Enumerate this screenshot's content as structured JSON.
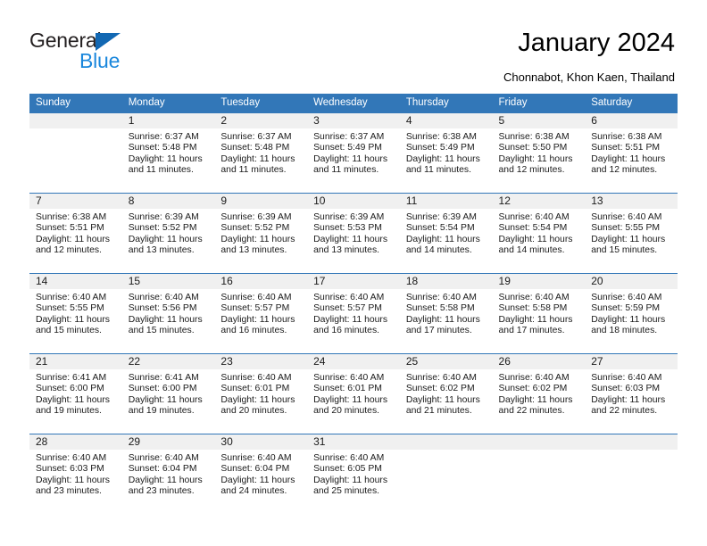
{
  "brand": {
    "name_part1": "General",
    "name_part2": "Blue",
    "triangle_icon": "triangle-icon",
    "color_dark": "#231f20",
    "color_blue": "#1a87dc",
    "color_triangle": "#1268b3"
  },
  "header": {
    "title": "January 2024",
    "subtitle": "Chonnabot, Khon Kaen, Thailand",
    "accent_color": "#3277b8",
    "band_color": "#f0f0f0"
  },
  "weekday_headers": [
    "Sunday",
    "Monday",
    "Tuesday",
    "Wednesday",
    "Thursday",
    "Friday",
    "Saturday"
  ],
  "weeks": [
    [
      {
        "day": "",
        "lines": []
      },
      {
        "day": "1",
        "lines": [
          "Sunrise: 6:37 AM",
          "Sunset: 5:48 PM",
          "Daylight: 11 hours",
          "and 11 minutes."
        ]
      },
      {
        "day": "2",
        "lines": [
          "Sunrise: 6:37 AM",
          "Sunset: 5:48 PM",
          "Daylight: 11 hours",
          "and 11 minutes."
        ]
      },
      {
        "day": "3",
        "lines": [
          "Sunrise: 6:37 AM",
          "Sunset: 5:49 PM",
          "Daylight: 11 hours",
          "and 11 minutes."
        ]
      },
      {
        "day": "4",
        "lines": [
          "Sunrise: 6:38 AM",
          "Sunset: 5:49 PM",
          "Daylight: 11 hours",
          "and 11 minutes."
        ]
      },
      {
        "day": "5",
        "lines": [
          "Sunrise: 6:38 AM",
          "Sunset: 5:50 PM",
          "Daylight: 11 hours",
          "and 12 minutes."
        ]
      },
      {
        "day": "6",
        "lines": [
          "Sunrise: 6:38 AM",
          "Sunset: 5:51 PM",
          "Daylight: 11 hours",
          "and 12 minutes."
        ]
      }
    ],
    [
      {
        "day": "7",
        "lines": [
          "Sunrise: 6:38 AM",
          "Sunset: 5:51 PM",
          "Daylight: 11 hours",
          "and 12 minutes."
        ]
      },
      {
        "day": "8",
        "lines": [
          "Sunrise: 6:39 AM",
          "Sunset: 5:52 PM",
          "Daylight: 11 hours",
          "and 13 minutes."
        ]
      },
      {
        "day": "9",
        "lines": [
          "Sunrise: 6:39 AM",
          "Sunset: 5:52 PM",
          "Daylight: 11 hours",
          "and 13 minutes."
        ]
      },
      {
        "day": "10",
        "lines": [
          "Sunrise: 6:39 AM",
          "Sunset: 5:53 PM",
          "Daylight: 11 hours",
          "and 13 minutes."
        ]
      },
      {
        "day": "11",
        "lines": [
          "Sunrise: 6:39 AM",
          "Sunset: 5:54 PM",
          "Daylight: 11 hours",
          "and 14 minutes."
        ]
      },
      {
        "day": "12",
        "lines": [
          "Sunrise: 6:40 AM",
          "Sunset: 5:54 PM",
          "Daylight: 11 hours",
          "and 14 minutes."
        ]
      },
      {
        "day": "13",
        "lines": [
          "Sunrise: 6:40 AM",
          "Sunset: 5:55 PM",
          "Daylight: 11 hours",
          "and 15 minutes."
        ]
      }
    ],
    [
      {
        "day": "14",
        "lines": [
          "Sunrise: 6:40 AM",
          "Sunset: 5:55 PM",
          "Daylight: 11 hours",
          "and 15 minutes."
        ]
      },
      {
        "day": "15",
        "lines": [
          "Sunrise: 6:40 AM",
          "Sunset: 5:56 PM",
          "Daylight: 11 hours",
          "and 15 minutes."
        ]
      },
      {
        "day": "16",
        "lines": [
          "Sunrise: 6:40 AM",
          "Sunset: 5:57 PM",
          "Daylight: 11 hours",
          "and 16 minutes."
        ]
      },
      {
        "day": "17",
        "lines": [
          "Sunrise: 6:40 AM",
          "Sunset: 5:57 PM",
          "Daylight: 11 hours",
          "and 16 minutes."
        ]
      },
      {
        "day": "18",
        "lines": [
          "Sunrise: 6:40 AM",
          "Sunset: 5:58 PM",
          "Daylight: 11 hours",
          "and 17 minutes."
        ]
      },
      {
        "day": "19",
        "lines": [
          "Sunrise: 6:40 AM",
          "Sunset: 5:58 PM",
          "Daylight: 11 hours",
          "and 17 minutes."
        ]
      },
      {
        "day": "20",
        "lines": [
          "Sunrise: 6:40 AM",
          "Sunset: 5:59 PM",
          "Daylight: 11 hours",
          "and 18 minutes."
        ]
      }
    ],
    [
      {
        "day": "21",
        "lines": [
          "Sunrise: 6:41 AM",
          "Sunset: 6:00 PM",
          "Daylight: 11 hours",
          "and 19 minutes."
        ]
      },
      {
        "day": "22",
        "lines": [
          "Sunrise: 6:41 AM",
          "Sunset: 6:00 PM",
          "Daylight: 11 hours",
          "and 19 minutes."
        ]
      },
      {
        "day": "23",
        "lines": [
          "Sunrise: 6:40 AM",
          "Sunset: 6:01 PM",
          "Daylight: 11 hours",
          "and 20 minutes."
        ]
      },
      {
        "day": "24",
        "lines": [
          "Sunrise: 6:40 AM",
          "Sunset: 6:01 PM",
          "Daylight: 11 hours",
          "and 20 minutes."
        ]
      },
      {
        "day": "25",
        "lines": [
          "Sunrise: 6:40 AM",
          "Sunset: 6:02 PM",
          "Daylight: 11 hours",
          "and 21 minutes."
        ]
      },
      {
        "day": "26",
        "lines": [
          "Sunrise: 6:40 AM",
          "Sunset: 6:02 PM",
          "Daylight: 11 hours",
          "and 22 minutes."
        ]
      },
      {
        "day": "27",
        "lines": [
          "Sunrise: 6:40 AM",
          "Sunset: 6:03 PM",
          "Daylight: 11 hours",
          "and 22 minutes."
        ]
      }
    ],
    [
      {
        "day": "28",
        "lines": [
          "Sunrise: 6:40 AM",
          "Sunset: 6:03 PM",
          "Daylight: 11 hours",
          "and 23 minutes."
        ]
      },
      {
        "day": "29",
        "lines": [
          "Sunrise: 6:40 AM",
          "Sunset: 6:04 PM",
          "Daylight: 11 hours",
          "and 23 minutes."
        ]
      },
      {
        "day": "30",
        "lines": [
          "Sunrise: 6:40 AM",
          "Sunset: 6:04 PM",
          "Daylight: 11 hours",
          "and 24 minutes."
        ]
      },
      {
        "day": "31",
        "lines": [
          "Sunrise: 6:40 AM",
          "Sunset: 6:05 PM",
          "Daylight: 11 hours",
          "and 25 minutes."
        ]
      },
      {
        "day": "",
        "lines": []
      },
      {
        "day": "",
        "lines": []
      },
      {
        "day": "",
        "lines": []
      }
    ]
  ]
}
